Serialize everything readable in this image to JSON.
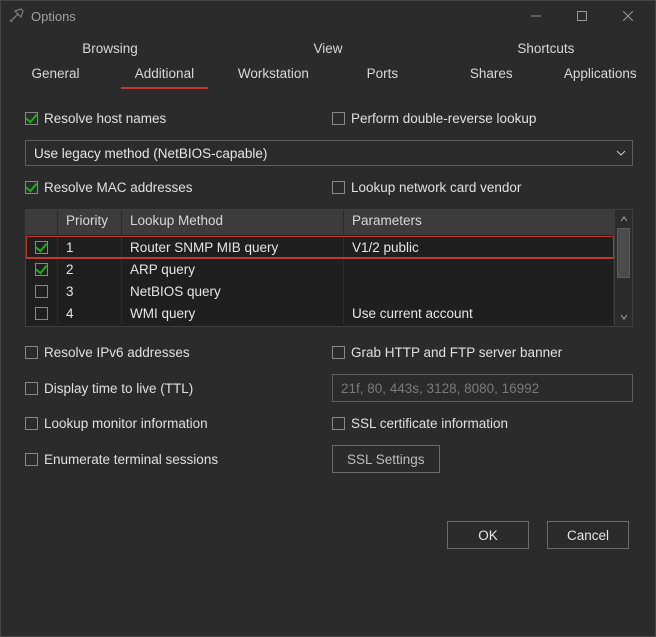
{
  "window": {
    "title": "Options"
  },
  "tabs_top": [
    {
      "label": "Browsing"
    },
    {
      "label": "View"
    },
    {
      "label": "Shortcuts"
    }
  ],
  "tabs_bottom": [
    {
      "label": "General"
    },
    {
      "label": "Additional",
      "active": true
    },
    {
      "label": "Workstation"
    },
    {
      "label": "Ports"
    },
    {
      "label": "Shares"
    },
    {
      "label": "Applications"
    }
  ],
  "options": {
    "resolve_host_names": {
      "label": "Resolve host names",
      "checked": true
    },
    "double_reverse": {
      "label": "Perform double-reverse lookup",
      "checked": false
    },
    "method_select": {
      "value": "Use legacy method (NetBIOS-capable)"
    },
    "resolve_mac": {
      "label": "Resolve MAC addresses",
      "checked": true
    },
    "lookup_vendor": {
      "label": "Lookup network card vendor",
      "checked": false
    },
    "resolve_ipv6": {
      "label": "Resolve IPv6 addresses",
      "checked": false
    },
    "grab_banner": {
      "label": "Grab HTTP and FTP server banner",
      "checked": false
    },
    "display_ttl": {
      "label": "Display time to live (TTL)",
      "checked": false
    },
    "ports_field": {
      "placeholder": "21f, 80, 443s, 3128, 8080, 16992"
    },
    "lookup_monitor": {
      "label": "Lookup monitor information",
      "checked": false
    },
    "ssl_cert": {
      "label": "SSL certificate information",
      "checked": false
    },
    "enumerate_sessions": {
      "label": "Enumerate terminal sessions",
      "checked": false
    }
  },
  "table": {
    "headers": {
      "priority": "Priority",
      "method": "Lookup Method",
      "params": "Parameters"
    },
    "rows": [
      {
        "checked": true,
        "priority": "1",
        "method": "Router SNMP MIB query",
        "params": "V1/2 public",
        "highlight": true
      },
      {
        "checked": true,
        "priority": "2",
        "method": "ARP query",
        "params": ""
      },
      {
        "checked": false,
        "priority": "3",
        "method": "NetBIOS query",
        "params": ""
      },
      {
        "checked": false,
        "priority": "4",
        "method": "WMI query",
        "params": "Use current account"
      }
    ]
  },
  "buttons": {
    "ssl_settings": "SSL Settings",
    "ok": "OK",
    "cancel": "Cancel"
  }
}
